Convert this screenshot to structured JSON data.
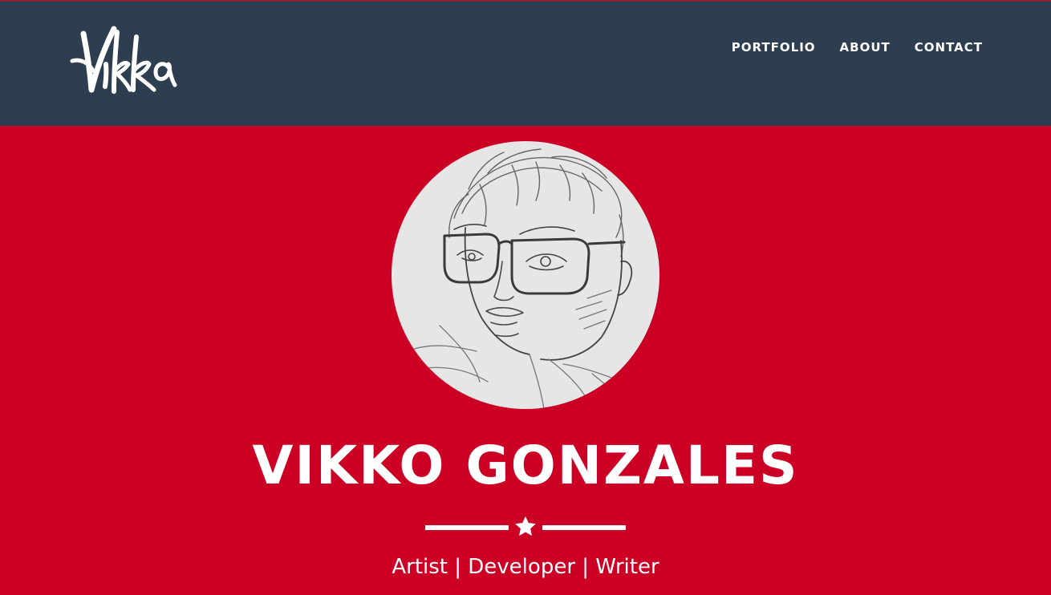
{
  "header": {
    "logo_text": "Vikko",
    "nav": [
      {
        "label": "PORTFOLIO"
      },
      {
        "label": "ABOUT"
      },
      {
        "label": "CONTACT"
      }
    ]
  },
  "hero": {
    "name": "VIKKO GONZALES",
    "tagline": "Artist | Developer | Writer",
    "avatar": "pencil-sketch-portrait",
    "divider_icon": "star-icon"
  },
  "colors": {
    "header_bg": "#2e3e51",
    "hero_bg": "#cc0025",
    "text": "#ffffff",
    "avatar_bg": "#e6e6e6"
  }
}
